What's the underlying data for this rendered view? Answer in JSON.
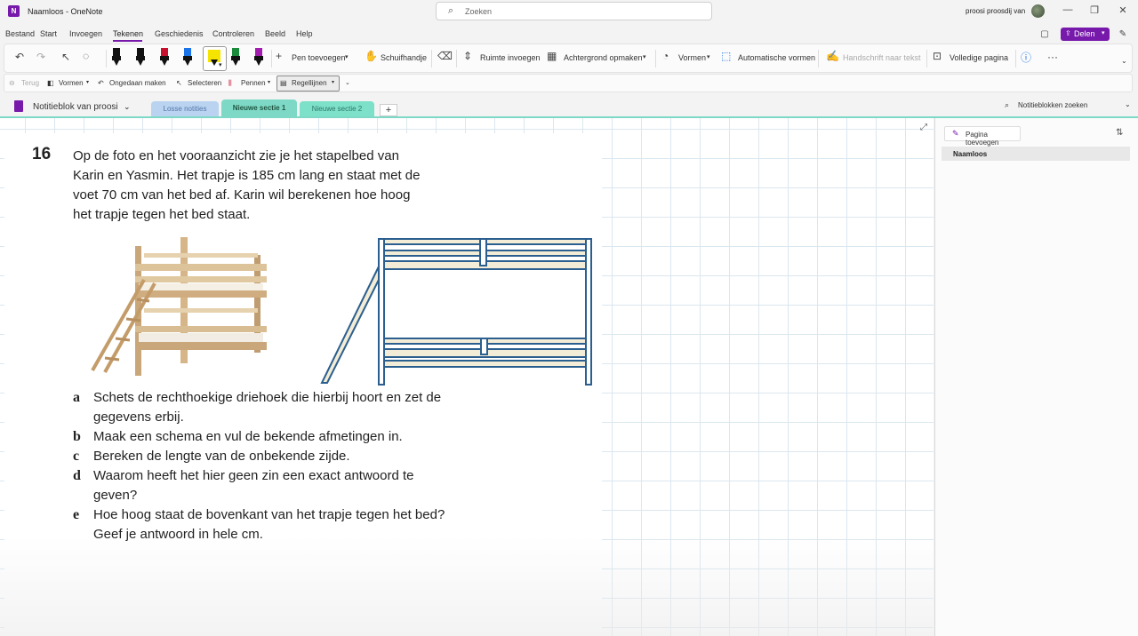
{
  "window": {
    "app_title": "Naamloos - OneNote",
    "search_placeholder": "Zoeken",
    "user_name": "proosi proosdij van",
    "minimize": "—",
    "restore": "❐",
    "close": "✕"
  },
  "menu": {
    "tabs": [
      "Bestand",
      "Start",
      "Invoegen",
      "Tekenen",
      "Geschiedenis",
      "Controleren",
      "Beeld",
      "Help"
    ],
    "active_tab": "Tekenen",
    "share_label": "Delen"
  },
  "ribbon": {
    "pen_colors": [
      "#111111",
      "#111111",
      "#c8102e",
      "#1a73e8",
      "#f5e400",
      "#1b8a3a",
      "#a21caf"
    ],
    "add_pen": "Pen toevoegen",
    "ruler": "Schuifhandje",
    "insert_space": "Ruimte invoegen",
    "background": "Achtergrond opmaken",
    "shapes": "Vormen",
    "auto_shapes": "Automatische vormen",
    "ink_to_text": "Handschrift naar tekst",
    "full_page": "Volledige pagina",
    "more": "···"
  },
  "quick_access": {
    "back": "Terug",
    "shapes": "Vormen",
    "undo": "Ongedaan maken",
    "select": "Selecteren",
    "pens": "Pennen",
    "rule_lines": "Regellijnen"
  },
  "notebook": {
    "name": "Notitieblok van proosi",
    "sections": [
      {
        "label": "Losse notities",
        "color": "#b9d3f0"
      },
      {
        "label": "Nieuwe sectie 1",
        "color": "#7dd9c5"
      },
      {
        "label": "Nieuwe sectie 2",
        "color": "#7de0c8"
      }
    ],
    "add_section": "+",
    "search_placeholder": "Notitieblokken zoeken"
  },
  "content": {
    "question_number": "16",
    "question_lines": [
      "Op de foto en het vooraanzicht zie je het stapelbed van",
      "Karin en Yasmin. Het trapje is 185 cm lang en staat met de",
      "voet 70 cm van het bed af. Karin wil berekenen hoe hoog",
      "het trapje tegen het bed staat."
    ],
    "subquestions": [
      {
        "letter": "a",
        "text": "Schets de rechthoekige driehoek die hierbij hoort en zet de gegevens erbij."
      },
      {
        "letter": "b",
        "text": "Maak een schema en vul de bekende afmetingen in."
      },
      {
        "letter": "c",
        "text": "Bereken de lengte van de onbekende zijde."
      },
      {
        "letter": "d",
        "text": "Waarom heeft het hier geen zin een exact antwoord te geven?"
      },
      {
        "letter": "e",
        "text": "Hoe hoog staat de bovenkant van het trapje tegen het bed? Geef je antwoord in hele cm."
      }
    ]
  },
  "pages_pane": {
    "add_page": "Pagina toevoegen",
    "pages": [
      "Naamloos"
    ]
  }
}
